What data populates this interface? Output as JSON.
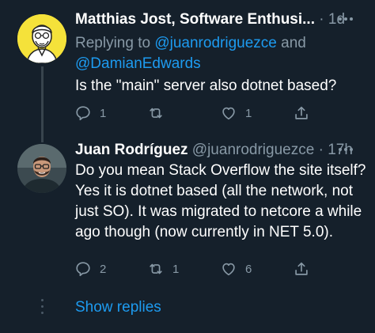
{
  "colors": {
    "background": "#15202b",
    "text_primary": "#ffffff",
    "text_secondary": "#8899a6",
    "link": "#1d9bf0",
    "avatar_1_bg": "#f5e23a"
  },
  "tweets": [
    {
      "author_name": "Matthias Jost, Software Enthusi...",
      "handle": "",
      "separator": "·",
      "time": "1d",
      "reply_prefix": "Replying to ",
      "reply_mention_1": "@juanrodriguezce",
      "reply_and": " and ",
      "reply_mention_2": "@DamianEdwards",
      "text": "Is the \"main\" server also dotnet based?",
      "reply_count": "1",
      "retweet_count": "",
      "like_count": "1",
      "avatar_icon": "cartoon-avatar-icon"
    },
    {
      "author_name": "Juan Rodríguez",
      "handle": "@juanrodriguezce",
      "separator": "·",
      "time": "17h",
      "text": "Do you mean Stack Overflow the site itself? Yes it is dotnet based (all the network, not just SO). It was migrated to netcore a while ago though (now currently in NET 5.0).",
      "reply_count": "2",
      "retweet_count": "1",
      "like_count": "6",
      "avatar_icon": "photo-avatar-icon"
    }
  ],
  "show_replies_label": "Show replies",
  "icons": [
    "reply-icon",
    "retweet-icon",
    "like-icon",
    "share-icon",
    "more-icon"
  ]
}
